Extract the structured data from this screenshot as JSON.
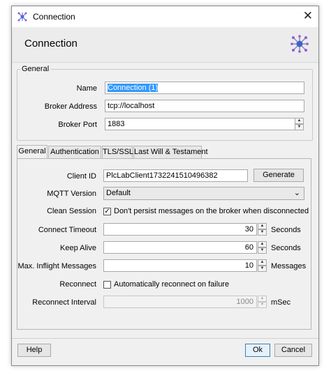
{
  "window": {
    "title": "Connection"
  },
  "header": {
    "title": "Connection"
  },
  "general": {
    "legend": "General",
    "name_label": "Name",
    "name_value": "Connection (1)",
    "broker_address_label": "Broker Address",
    "broker_address_value": "tcp://localhost",
    "broker_port_label": "Broker Port",
    "broker_port_value": "1883"
  },
  "tabs": [
    {
      "label": "General"
    },
    {
      "label": "Authentication"
    },
    {
      "label": "TLS/SSL"
    },
    {
      "label": "Last Will & Testament"
    }
  ],
  "panel": {
    "client_id_label": "Client ID",
    "client_id_value": "PlcLabClient1732241510496382",
    "generate_label": "Generate",
    "mqtt_version_label": "MQTT Version",
    "mqtt_version_value": "Default",
    "clean_session_label": "Clean Session",
    "clean_session_text": "Don't persist messages on the broker when disconnected",
    "connect_timeout_label": "Connect Timeout",
    "connect_timeout_value": "30",
    "connect_timeout_unit": "Seconds",
    "keep_alive_label": "Keep Alive",
    "keep_alive_value": "60",
    "keep_alive_unit": "Seconds",
    "max_inflight_label": "Max. Inflight Messages",
    "max_inflight_value": "10",
    "max_inflight_unit": "Messages",
    "reconnect_label": "Reconnect",
    "reconnect_text": "Automatically reconnect on failure",
    "reconnect_interval_label": "Reconnect Interval",
    "reconnect_interval_value": "1000",
    "reconnect_interval_unit": "mSec"
  },
  "footer": {
    "help_label": "Help",
    "ok_label": "Ok",
    "cancel_label": "Cancel"
  },
  "colors": {
    "selection": "#3399ff",
    "icon_accent": "#7b4fd6"
  }
}
